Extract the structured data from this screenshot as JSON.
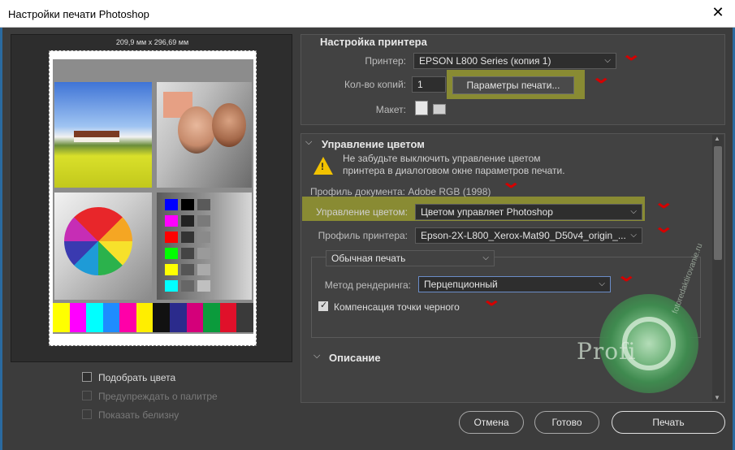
{
  "window": {
    "title": "Настройки печати Photoshop",
    "close_glyph": "✕"
  },
  "preview": {
    "dimensions": "209,9 мм x 296,69 мм",
    "color_bar": [
      "#ffff00",
      "#ff00ff",
      "#00ffff",
      "#1e8cff",
      "#ff00a8",
      "#ffee00",
      "#111111",
      "#2b2b8c",
      "#d4007a",
      "#0b9b3c",
      "#e0102a",
      "#3a3a3a"
    ],
    "chips": [
      "#0000ff",
      "#000000",
      "#5a5a5a",
      "#ff00ff",
      "#222222",
      "#7a7a7a",
      "#ff0000",
      "#333333",
      "#8a8a8a",
      "#00ff00",
      "#444444",
      "#9a9a9a",
      "#ffff00",
      "#555555",
      "#aaaaaa",
      "#00ffff",
      "#666666",
      "#c0c0c0"
    ]
  },
  "printer_setup": {
    "heading": "Настройка принтера",
    "printer_label": "Принтер:",
    "printer_value": "EPSON L800 Series (копия 1)",
    "copies_label": "Кол-во копий:",
    "copies_value": "1",
    "print_settings_button": "Параметры печати...",
    "layout_label": "Макет:"
  },
  "color_management": {
    "heading": "Управление цветом",
    "warning": [
      "Не забудьте выключить управление цветом",
      "принтера в диалоговом окне параметров печати."
    ],
    "doc_profile": "Профиль документа: Adobe RGB (1998)",
    "cm_label": "Управление цветом:",
    "cm_value": "Цветом управляет Photoshop",
    "printer_profile_label": "Профиль принтера:",
    "printer_profile_value": "Epson-2X-L800_Xerox-Mat90_D50v4_origin_...",
    "print_mode_value": "Обычная печать",
    "rendering_label": "Метод рендеринга:",
    "rendering_value": "Перцепционный",
    "black_point_label": "Компенсация точки черного",
    "black_point_checked": true
  },
  "description": {
    "heading": "Описание"
  },
  "left_options": {
    "match_colors": "Подобрать цвета",
    "gamut_warning": "Предупреждать о палитре",
    "show_paper_white": "Показать белизну"
  },
  "footer": {
    "cancel": "Отмена",
    "done": "Готово",
    "print": "Печать"
  },
  "watermark": {
    "text": "Profi",
    "url": "fotoredaktirovanie.ru"
  },
  "colors": {
    "accent_red": "#d40000",
    "highlight": "#c4c828"
  }
}
